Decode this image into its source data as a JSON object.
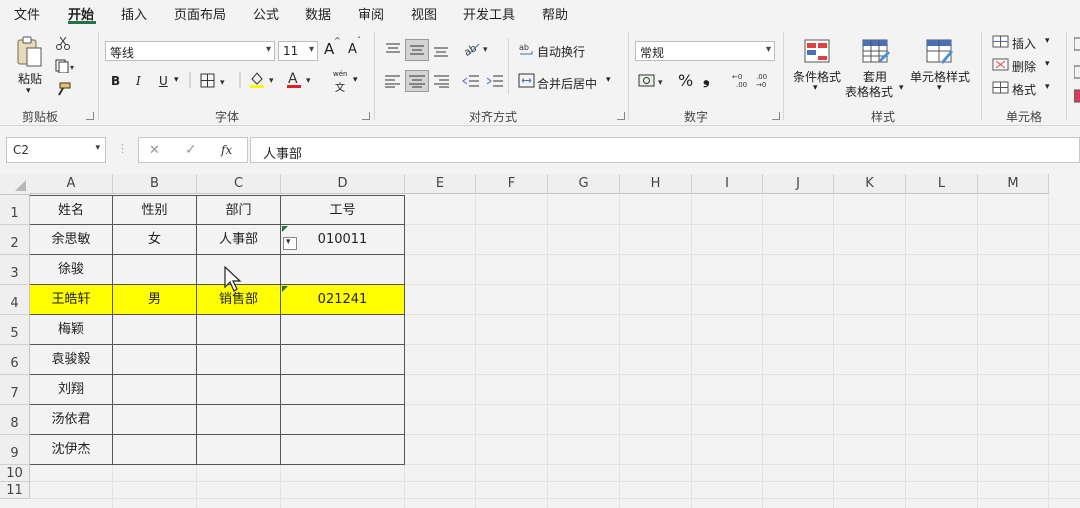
{
  "menu": {
    "tabs": [
      "文件",
      "开始",
      "插入",
      "页面布局",
      "公式",
      "数据",
      "审阅",
      "视图",
      "开发工具",
      "帮助"
    ],
    "active_index": 1
  },
  "ribbon": {
    "clipboard": {
      "paste": "粘贴",
      "label": "剪贴板"
    },
    "font": {
      "family": "等线",
      "size": "11",
      "grow": "A",
      "shrink": "A",
      "bold": "B",
      "italic": "I",
      "underline": "U",
      "phonetic": "wén",
      "label": "字体"
    },
    "alignment": {
      "wrap_text": "自动换行",
      "merge_center": "合并后居中",
      "label": "对齐方式"
    },
    "number": {
      "format": "常规",
      "percent": "%",
      "comma": "❟",
      "label": "数字"
    },
    "styles": {
      "conditional": "条件格式",
      "table_line1": "套用",
      "table_line2": "表格格式",
      "cell_styles": "单元格样式",
      "label": "样式"
    },
    "cells": {
      "insert": "插入",
      "delete": "删除",
      "format": "格式",
      "label": "单元格"
    }
  },
  "formula_bar": {
    "name_box": "C2",
    "cancel": "✕",
    "enter": "✓",
    "fx": "fx",
    "content": "人事部"
  },
  "columns": [
    "A",
    "B",
    "C",
    "D",
    "E",
    "F",
    "G",
    "H",
    "I",
    "J",
    "K",
    "L",
    "M"
  ],
  "rows": [
    "1",
    "2",
    "3",
    "4",
    "5",
    "6",
    "7",
    "8",
    "9",
    "10",
    "11"
  ],
  "table": {
    "header": [
      "姓名",
      "性别",
      "部门",
      "工号"
    ],
    "rows": [
      [
        "余思敏",
        "女",
        "人事部",
        "010011"
      ],
      [
        "徐骏",
        "",
        "",
        ""
      ],
      [
        "王皓轩",
        "男",
        "销售部",
        "021241"
      ],
      [
        "梅颖",
        "",
        "",
        ""
      ],
      [
        "袁骏毅",
        "",
        "",
        ""
      ],
      [
        "刘翔",
        "",
        "",
        ""
      ],
      [
        "汤依君",
        "",
        "",
        ""
      ],
      [
        "沈伊杰",
        "",
        "",
        ""
      ]
    ],
    "highlight_row_index": 2,
    "highlight_color": "#ffff00"
  },
  "colors": {
    "accent": "#217346",
    "font_color_bar": "#e02020",
    "fill_color_bar": "#ffff00"
  }
}
